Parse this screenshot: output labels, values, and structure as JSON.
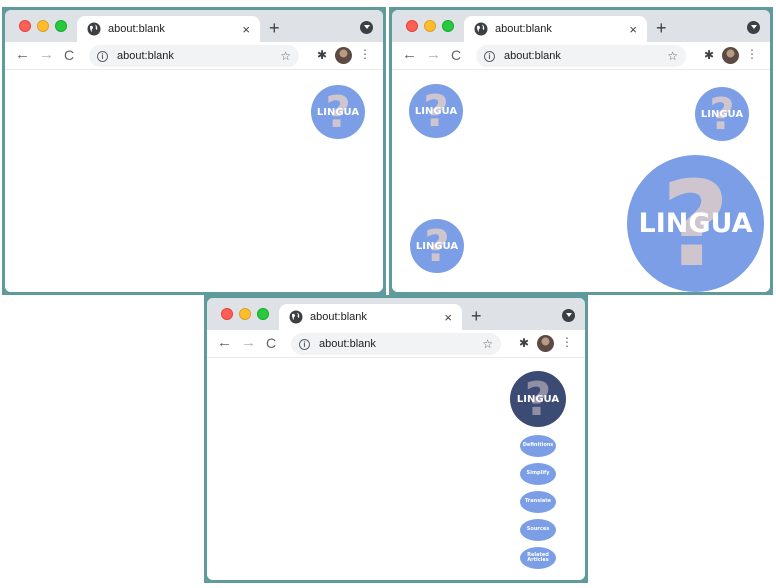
{
  "browser": {
    "tab_title": "about:blank",
    "tab_close": "×",
    "new_tab": "+",
    "url": "about:blank",
    "info_glyph": "i",
    "star": "☆",
    "extensions": "✱",
    "menu": "⋮",
    "nav": {
      "back": "←",
      "forward": "→",
      "reload": "C"
    },
    "colors": {
      "tab_strip": "#dee1e6",
      "frame": "#5f9a9c"
    }
  },
  "lingua": {
    "label": "LINGUA",
    "mark": "?",
    "colors": {
      "bubble": "#7b9ee6",
      "active": "#3c4b73",
      "question_mark": "#d8c9cb"
    }
  },
  "lingua_menu": [
    {
      "label": "Definitions"
    },
    {
      "label": "Simplify"
    },
    {
      "label": "Translate"
    },
    {
      "label": "Sources"
    },
    {
      "label": "Related Articles"
    }
  ]
}
